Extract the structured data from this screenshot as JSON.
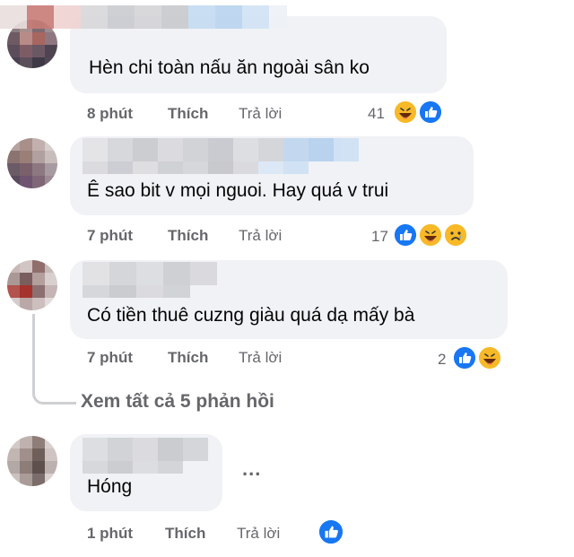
{
  "comments": [
    {
      "text": "Hèn chi toàn nấu ăn ngoài sân ko",
      "time": "8 phút",
      "like_label": "Thích",
      "reply_label": "Trả lời",
      "reaction_count": "41",
      "reactions": [
        "haha",
        "like"
      ]
    },
    {
      "text": "Ê sao bit v mọi nguoi. Hay quá v trui",
      "time": "7 phút",
      "like_label": "Thích",
      "reply_label": "Trả lời",
      "reaction_count": "17",
      "reactions": [
        "like",
        "haha",
        "sad"
      ]
    },
    {
      "text": "Có tiền thuê cuzng giàu quá dạ mấy bà",
      "time": "7 phút",
      "like_label": "Thích",
      "reply_label": "Trả lời",
      "reaction_count": "2",
      "reactions": [
        "like",
        "haha"
      ]
    },
    {
      "text": "Hóng",
      "time": "1 phút",
      "like_label": "Thích",
      "reply_label": "Trả lời",
      "reaction_count": "",
      "reactions": [
        "like"
      ]
    }
  ],
  "view_replies_label": "Xem tất cả 5 phản hồi",
  "more_options_label": "...",
  "colors": {
    "bubble": "#f0f2f5",
    "secondary_text": "#65676b",
    "like_blue": "#1877f2",
    "haha_yellow": "#f7b928"
  }
}
